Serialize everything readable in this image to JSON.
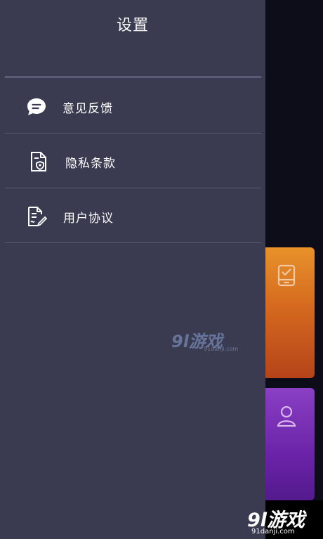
{
  "drawer": {
    "title": "设置",
    "items": [
      {
        "label": "意见反馈",
        "icon": "chat-bubble-icon"
      },
      {
        "label": "隐私条款",
        "icon": "privacy-document-icon"
      },
      {
        "label": "用户协议",
        "icon": "agreement-document-icon"
      }
    ]
  },
  "background": {
    "cards": [
      {
        "icon": "checklist-icon",
        "color": "#d46a1f"
      },
      {
        "icon": "user-icon",
        "color": "#6a23a8"
      }
    ]
  },
  "watermark": {
    "logo": "9l游戏",
    "url": "91danji.com"
  },
  "colors": {
    "drawer_bg": "#3a3a50",
    "backdrop": "#0c0d18",
    "text": "#ffffff"
  }
}
